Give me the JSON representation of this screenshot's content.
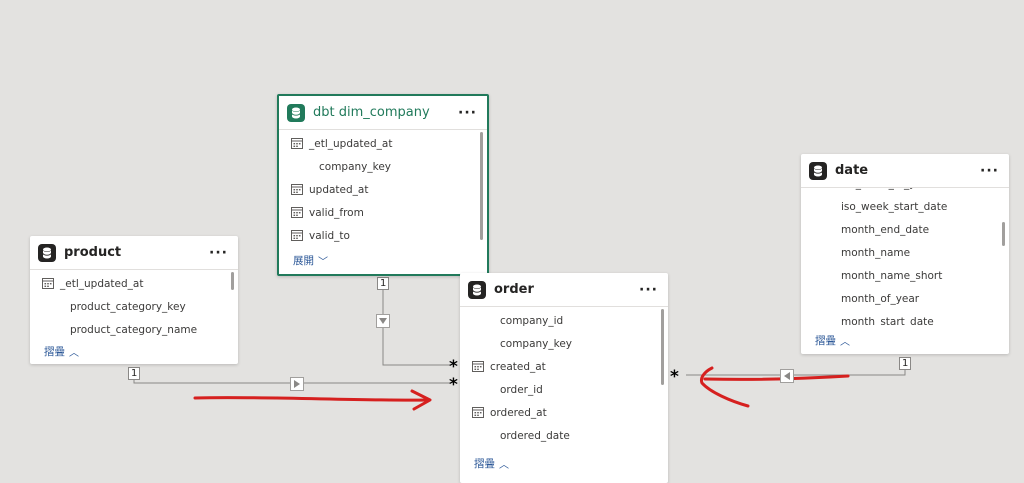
{
  "tables": {
    "product": {
      "title": "product",
      "fields": [
        "_etl_updated_at",
        "product_category_key",
        "product_category_name"
      ],
      "toggle": "摺疊"
    },
    "dim_company": {
      "title": "dbt dim_company",
      "fields": [
        "_etl_updated_at",
        "company_key",
        "updated_at",
        "valid_from",
        "valid_to"
      ],
      "toggle": "展開"
    },
    "order": {
      "title": "order",
      "fields": [
        "company_id",
        "company_key",
        "created_at",
        "order_id",
        "ordered_at",
        "ordered_date"
      ],
      "toggle": "摺疊"
    },
    "date": {
      "title": "date",
      "fields": [
        "iso_week_of_year",
        "iso_week_start_date",
        "month_end_date",
        "month_name",
        "month_name_short",
        "month_of_year",
        "month_start_date"
      ],
      "toggle": "摺疊"
    }
  },
  "menu_glyph": "···",
  "relationships": {
    "one_label": "1",
    "many_label": "*"
  },
  "colors": {
    "canvas": "#e3e2e0",
    "selected_border": "#217a5b",
    "annotation": "#d6201f",
    "link": "#2b5797"
  }
}
